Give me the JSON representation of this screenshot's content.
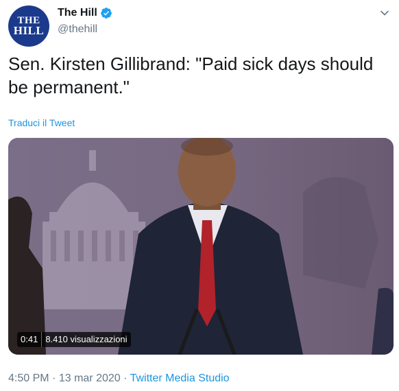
{
  "account": {
    "avatar_line1": "THE",
    "avatar_line2": "HILL",
    "display_name": "The Hill",
    "handle": "@thehill"
  },
  "tweet": {
    "text": "Sen. Kirsten Gillibrand: \"Paid sick days should be permanent.\"",
    "translate_label": "Traduci il Tweet"
  },
  "video": {
    "duration": "0:41",
    "views": "8.410 visualizzazioni"
  },
  "meta": {
    "time": "4:50 PM",
    "separator1": "·",
    "date": "13 mar 2020",
    "separator2": "·",
    "source": "Twitter Media Studio"
  },
  "colors": {
    "link": "#1b95e0",
    "avatar_bg": "#1b3a8c",
    "verified": "#1da1f2",
    "secondary_text": "#657786"
  }
}
